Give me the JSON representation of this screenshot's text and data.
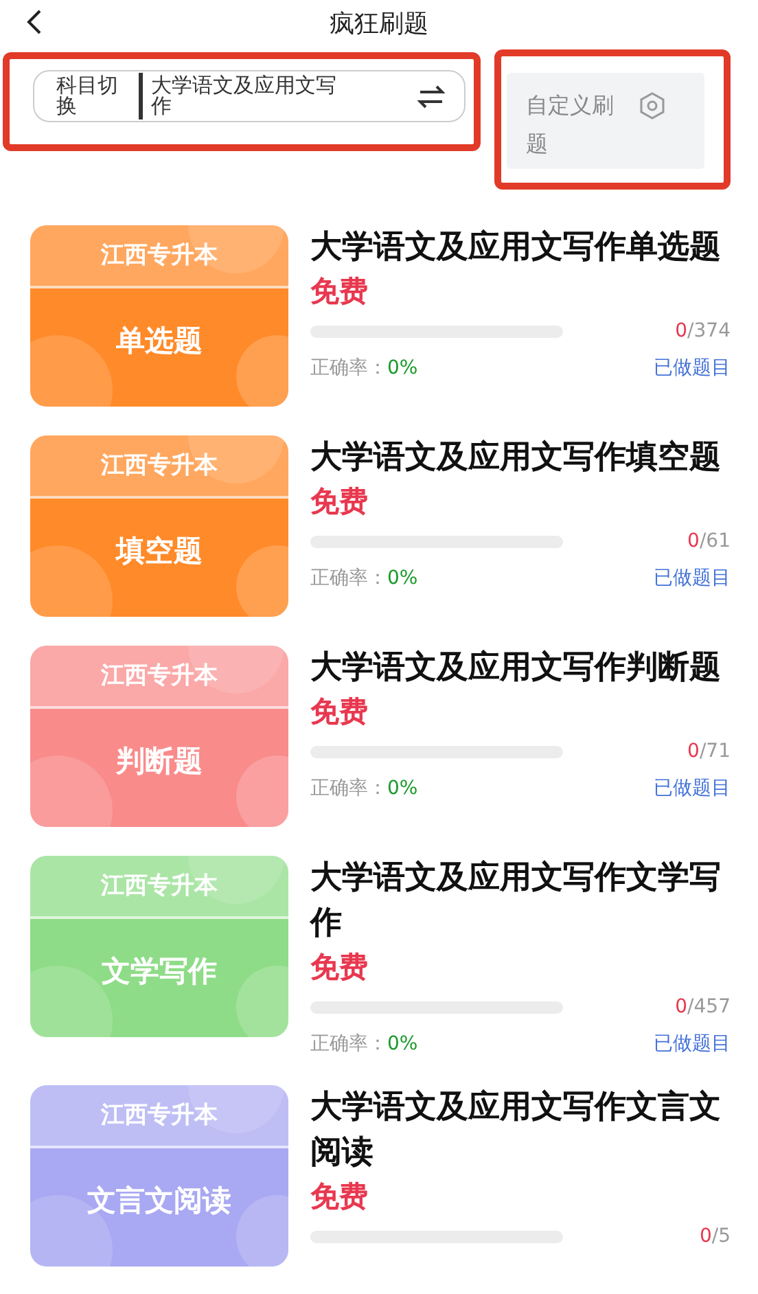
{
  "header": {
    "title": "疯狂刷题"
  },
  "subject_switch": {
    "label": "科目切换",
    "value": "大学语文及应用文写作"
  },
  "custom_button": {
    "label": "自定义刷题"
  },
  "cards": [
    {
      "color": "#ff8a2a",
      "top_label": "江西专升本",
      "label": "单选题",
      "title": "大学语文及应用文写作单选题",
      "price": "免费",
      "level": 0,
      "done": "0",
      "total": "/374",
      "accuracy_label": "正确率：",
      "accuracy": "0%",
      "link": "已做题目"
    },
    {
      "color": "#ff8a2a",
      "top_label": "江西专升本",
      "label": "填空题",
      "title": "大学语文及应用文写作填空题",
      "price": "免费",
      "level": 0,
      "done": "0",
      "total": "/61",
      "accuracy_label": "正确率：",
      "accuracy": "0%",
      "link": "已做题目"
    },
    {
      "color": "#f98b8b",
      "top_label": "江西专升本",
      "label": "判断题",
      "title": "大学语文及应用文写作判断题",
      "price": "免费",
      "level": 0,
      "done": "0",
      "total": "/71",
      "accuracy_label": "正确率：",
      "accuracy": "0%",
      "link": "已做题目"
    },
    {
      "color": "#8fdc88",
      "top_label": "江西专升本",
      "label": "文学写作",
      "title": "大学语文及应用文写作文学写作",
      "price": "免费",
      "level": 0,
      "done": "0",
      "total": "/457",
      "accuracy_label": "正确率：",
      "accuracy": "0%",
      "link": "已做题目"
    },
    {
      "color": "#a9a8f2",
      "top_label": "江西专升本",
      "label": "文言文阅读",
      "title": "大学语文及应用文写作文言文阅读",
      "price": "免费",
      "level": 0,
      "done": "0",
      "total": "/5"
    }
  ]
}
